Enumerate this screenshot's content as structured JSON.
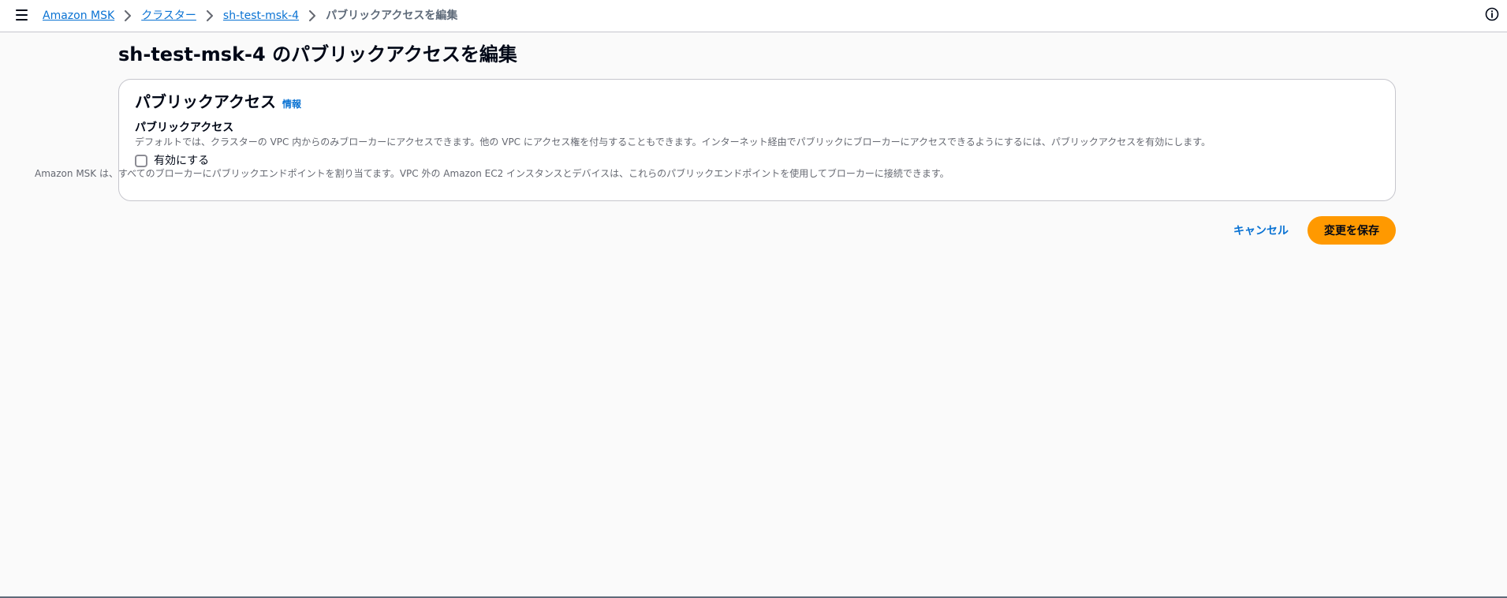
{
  "breadcrumb": {
    "items": [
      "Amazon MSK",
      "クラスター",
      "sh-test-msk-4"
    ],
    "current": "パブリックアクセスを編集"
  },
  "page": {
    "title": "sh-test-msk-4 のパブリックアクセスを編集"
  },
  "section": {
    "title": "パブリックアクセス",
    "info_link": "情報",
    "field_label": "パブリックアクセス",
    "field_description": "デフォルトでは、クラスターの VPC 内からのみブローカーにアクセスできます。他の VPC にアクセス権を付与することもできます。インターネット経由でパブリックにブローカーにアクセスできるようにするには、パブリックアクセスを有効にします。",
    "checkbox": {
      "label": "有効にする",
      "checked": false,
      "description": "Amazon MSK は、すべてのブローカーにパブリックエンドポイントを割り当てます。VPC 外の Amazon EC2 インスタンスとデバイスは、これらのパブリックエンドポイントを使用してブローカーに接続できます。"
    }
  },
  "actions": {
    "cancel_label": "キャンセル",
    "save_label": "変更を保存"
  },
  "colors": {
    "link": "#0972d3",
    "primary_button": "#ff9900",
    "text": "#000716",
    "secondary_text": "#656871"
  },
  "icons": {
    "menu": "hamburger-menu-icon",
    "separator": "chevron-right-icon",
    "info": "info-circle-icon"
  }
}
